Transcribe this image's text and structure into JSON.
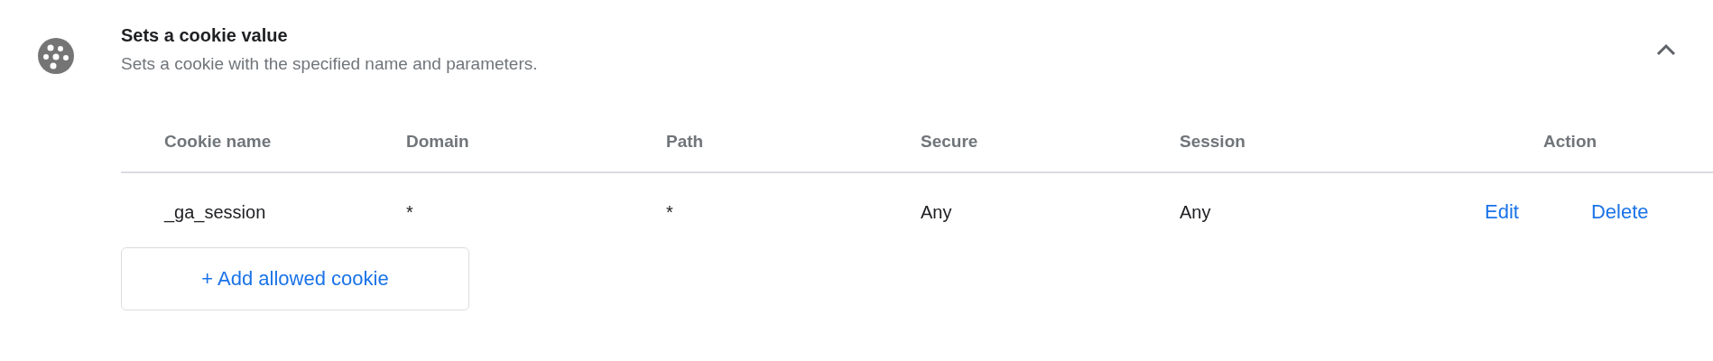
{
  "section": {
    "title": "Sets a cookie value",
    "description": "Sets a cookie with the specified name and parameters.",
    "expanded": true
  },
  "table": {
    "columns": [
      "Cookie name",
      "Domain",
      "Path",
      "Secure",
      "Session",
      "Action"
    ],
    "rows": [
      {
        "cells": [
          "_ga_session",
          "*",
          "*",
          "Any",
          "Any"
        ],
        "actions": [
          "Edit",
          "Delete"
        ]
      }
    ]
  },
  "add_button": "+ Add allowed cookie"
}
